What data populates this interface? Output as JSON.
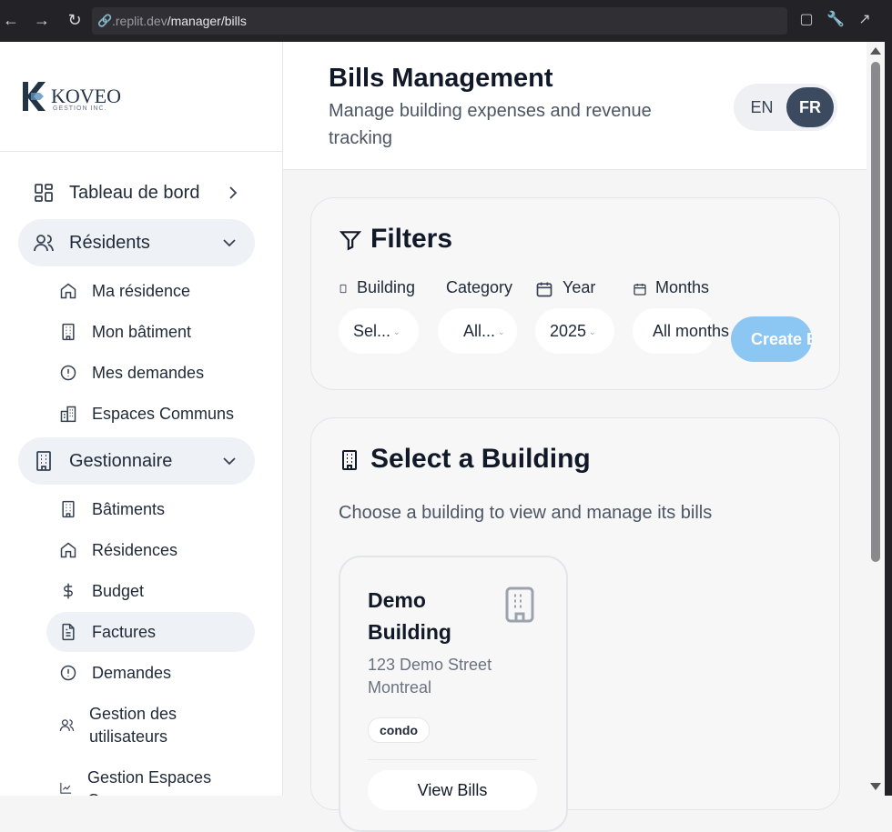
{
  "browser": {
    "url_host": ".replit.dev",
    "url_path": "/manager/bills"
  },
  "brand": {
    "name": "KOVEO",
    "tagline": "GESTION INC."
  },
  "sidebar": {
    "items": [
      {
        "label": "Tableau de bord",
        "icon": "dashboard-icon"
      },
      {
        "label": "Résidents",
        "icon": "users-icon"
      },
      {
        "label": "Ma résidence",
        "icon": "home-icon"
      },
      {
        "label": "Mon bâtiment",
        "icon": "building-icon"
      },
      {
        "label": "Mes demandes",
        "icon": "alert-circle-icon"
      },
      {
        "label": "Espaces Communs",
        "icon": "common-spaces-icon"
      },
      {
        "label": "Gestionnaire",
        "icon": "building-icon"
      },
      {
        "label": "Bâtiments",
        "icon": "building-icon"
      },
      {
        "label": "Résidences",
        "icon": "home-icon"
      },
      {
        "label": "Budget",
        "icon": "dollar-icon"
      },
      {
        "label": "Factures",
        "icon": "file-text-icon"
      },
      {
        "label": "Demandes",
        "icon": "alert-circle-icon"
      },
      {
        "label": "Gestion des utilisateurs",
        "icon": "users-icon"
      },
      {
        "label": "Gestion Espaces Communs",
        "icon": "chart-icon"
      }
    ]
  },
  "header": {
    "title": "Bills Management",
    "subtitle": "Manage building expenses and revenue tracking",
    "lang_en": "EN",
    "lang_fr": "FR"
  },
  "filters": {
    "title": "Filters",
    "building_label": "Building",
    "building_value": "Sel...",
    "category_label": "Category",
    "category_value": "All...",
    "year_label": "Year",
    "year_value": "2025",
    "months_label": "Months",
    "months_value": "All months",
    "create_label": "Create Bill"
  },
  "select_building": {
    "title": "Select a Building",
    "description": "Choose a building to view and manage its bills",
    "buildings": [
      {
        "name": "Demo Building",
        "address": "123 Demo Street Montreal",
        "type": "condo",
        "action": "View Bills"
      }
    ]
  },
  "colors": {
    "accent_dark": "#3b4a5e",
    "create_button": "#8cc6f2"
  }
}
